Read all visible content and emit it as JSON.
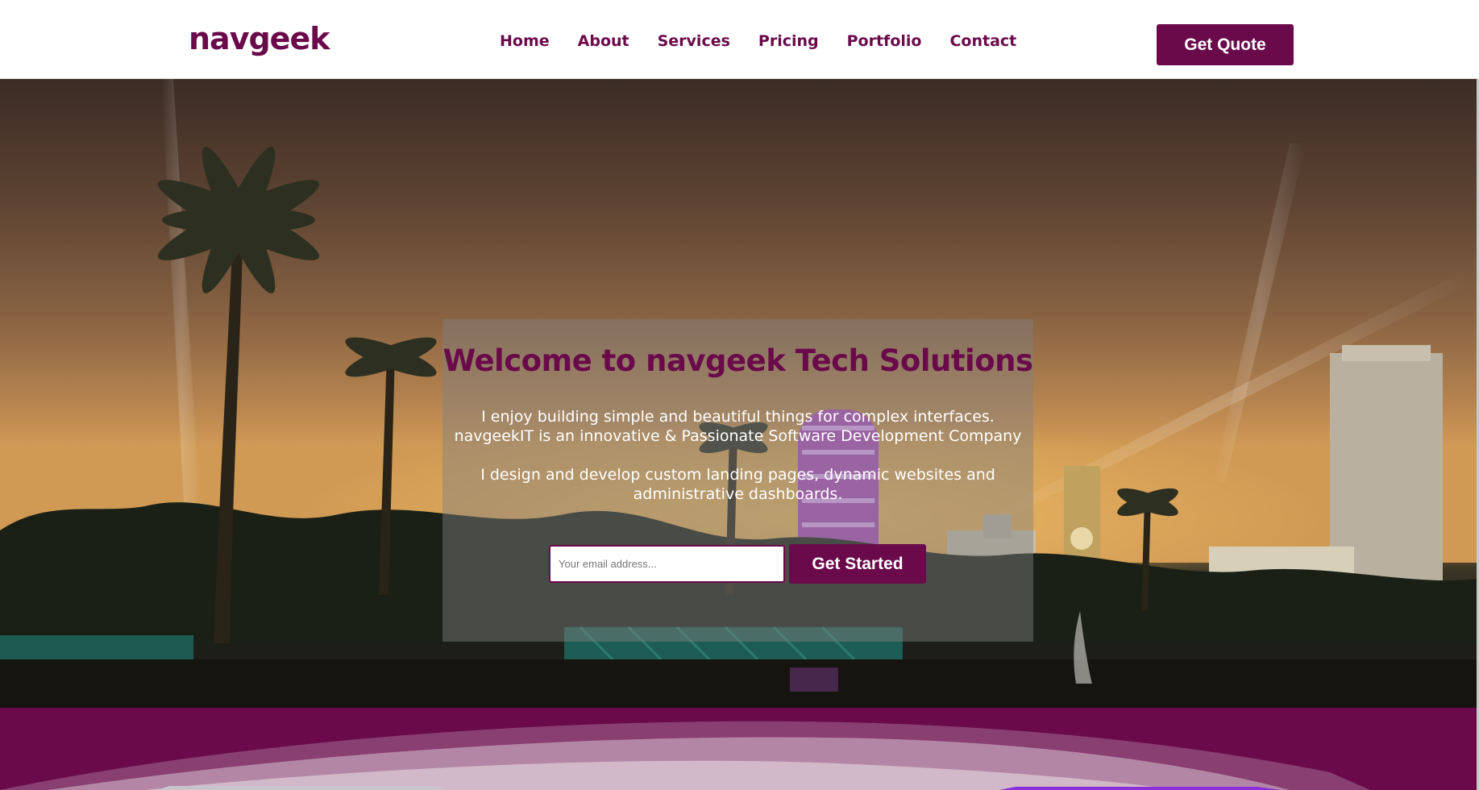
{
  "header": {
    "logo": "navgeek",
    "nav": [
      "Home",
      "About",
      "Services",
      "Pricing",
      "Portfolio",
      "Contact"
    ],
    "cta_label": "Get Quote"
  },
  "hero": {
    "title": "Welcome to navgeek Tech Solutions",
    "paragraph1_line1": "I enjoy building simple and beautiful things for complex interfaces.",
    "paragraph1_line2": "navgeekIT is an innovative & Passionate Software Development Company",
    "paragraph2_line1": "I design and develop custom landing pages, dynamic websites and",
    "paragraph2_line2": "administrative dashboards.",
    "email_placeholder": "Your email address...",
    "email_value": "",
    "start_label": "Get Started"
  },
  "colors": {
    "brand": "#6a0a4a",
    "white": "#ffffff"
  },
  "icons": [
    "navgeek-logo"
  ]
}
